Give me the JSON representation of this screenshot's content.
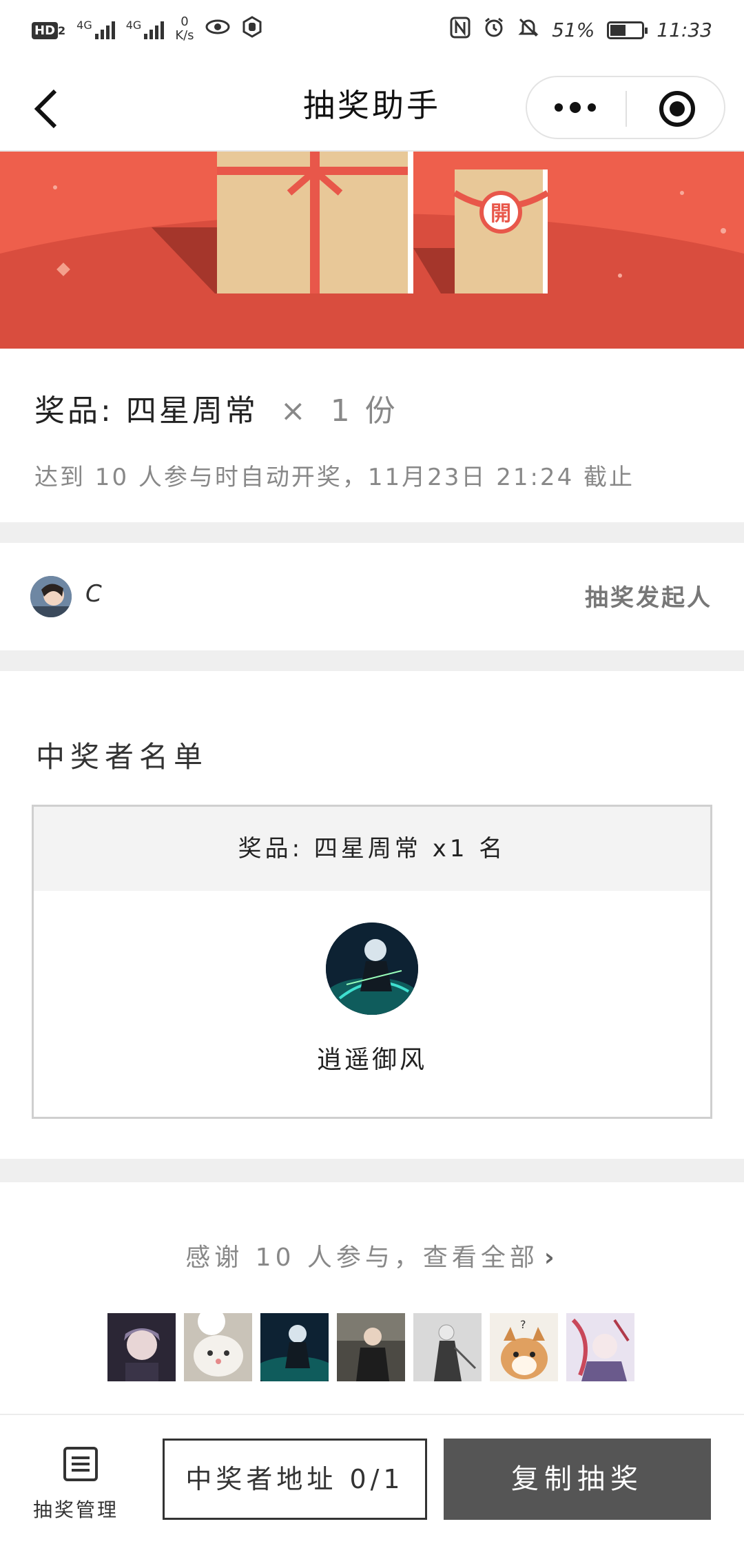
{
  "status_bar": {
    "left_badge": "HD",
    "left_badge_sub": "2",
    "net1": "4G",
    "net2": "4G",
    "speed_value": "0",
    "speed_unit": "K/s",
    "battery_percent": "51%",
    "battery_level": 0.51,
    "time": "11:33"
  },
  "nav": {
    "title": "抽奖助手"
  },
  "prize": {
    "label": "奖品:",
    "name": "四星周常",
    "times": "×",
    "quantity": "1 份",
    "condition": "达到 10 人参与时自动开奖，11月23日 21:24 截止"
  },
  "banner": {
    "envelope_char": "開"
  },
  "initiator": {
    "name": "C",
    "role": "抽奖发起人"
  },
  "winners": {
    "title": "中奖者名单",
    "prize_header": "奖品: 四星周常 x1 名",
    "winner_name": "逍遥御风"
  },
  "participants": {
    "thanks_text": "感谢 10 人参与，查看全部",
    "chevron": "›"
  },
  "bottom": {
    "management_label": "抽奖管理",
    "address_button": "中奖者地址 0/1",
    "copy_button": "复制抽奖"
  }
}
